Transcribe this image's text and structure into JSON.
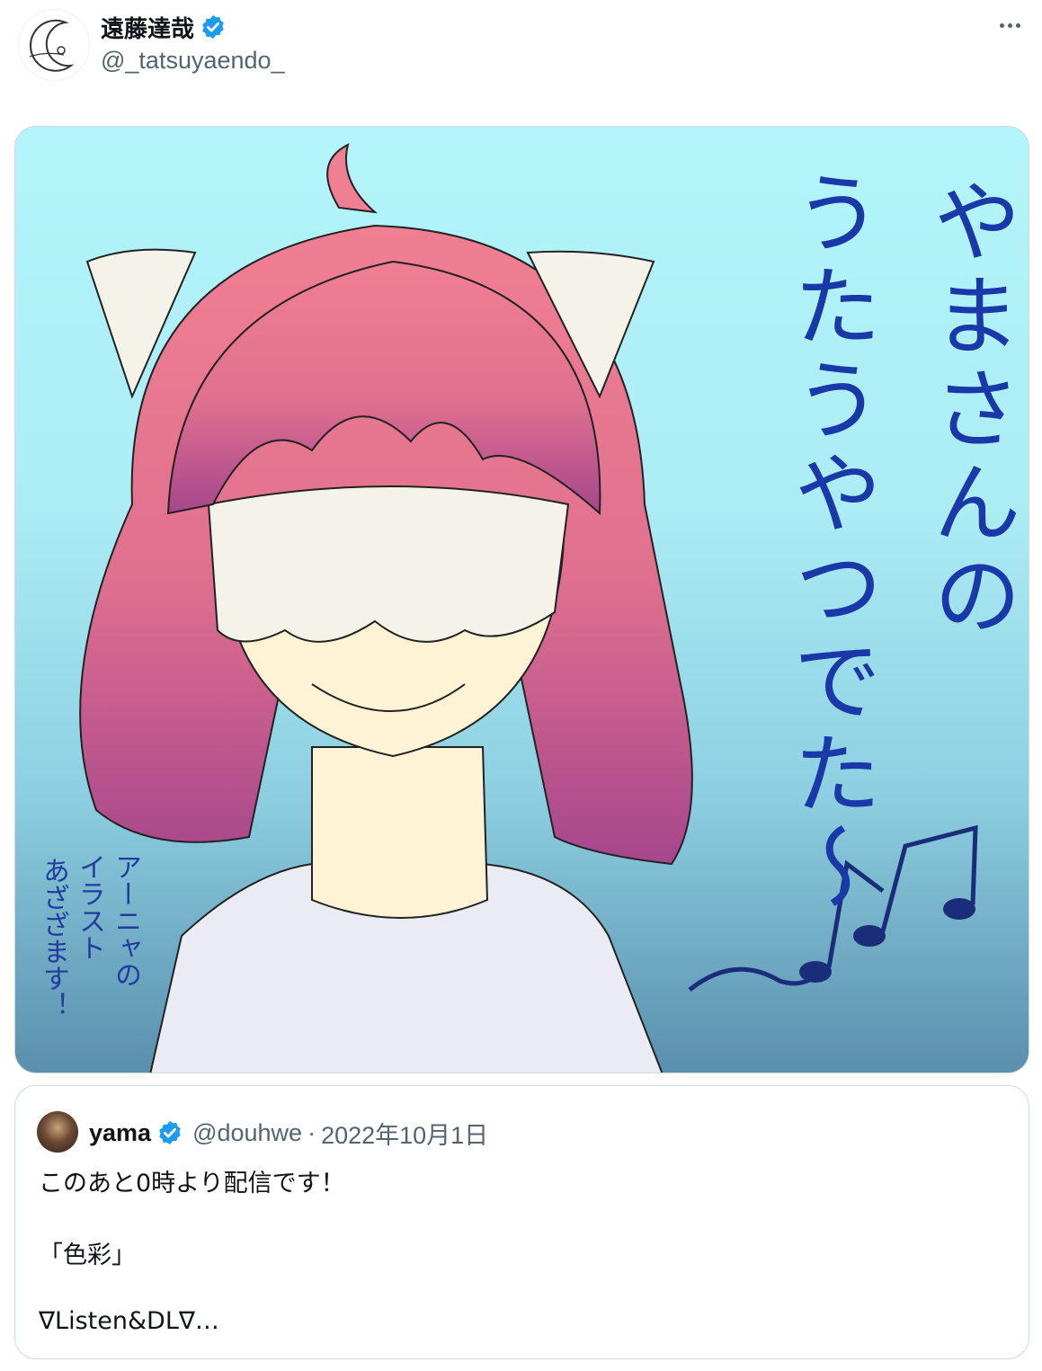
{
  "author": {
    "display_name": "遠藤達哉",
    "handle": "@_tatsuyaendo_",
    "verified": true,
    "avatar_icon": "crescent-moon-logo"
  },
  "actions": {
    "more_icon": "more-horizontal-icon"
  },
  "media": {
    "alt_description": "illustration of girl with pink hair and cat-ear headband",
    "art_text": {
      "line1": "やまさんの",
      "line2": "うたうやつでた〜",
      "note_line1": "アーニャの",
      "note_line2": "イラスト",
      "note_line3": "あざざます！"
    }
  },
  "quoted_post": {
    "display_name": "yama",
    "handle": "@douhwe",
    "separator": "·",
    "date": "2022年10月1日",
    "verified": true,
    "lines": [
      "このあと0時より配信です！",
      "「色彩」",
      "∇Listen&DL∇…"
    ]
  },
  "colors": {
    "verified_blue": "#1d9bf0",
    "text_primary": "#0f1419",
    "text_secondary": "#536471",
    "border": "#cfd9de"
  }
}
